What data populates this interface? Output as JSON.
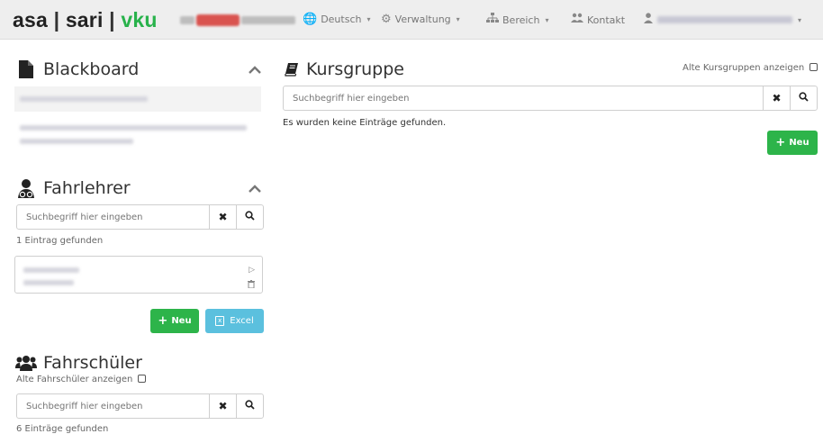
{
  "navbar": {
    "brand": {
      "part1": "asa",
      "part2": "sari",
      "part3": "vku",
      "separator": "|"
    },
    "language": {
      "label": "Deutsch",
      "icon": "globe-icon"
    },
    "admin": {
      "label": "Verwaltung",
      "icon": "cogs-icon"
    },
    "area": {
      "label": "Bereich",
      "icon": "sitemap-icon"
    },
    "contact": {
      "label": "Kontakt",
      "icon": "contacts-icon"
    },
    "user": {
      "icon": "user-icon"
    }
  },
  "blackboard": {
    "title": "Blackboard",
    "icon": "file-icon"
  },
  "fahrlehrer": {
    "title": "Fahrlehrer",
    "icon": "driving-instructor-icon",
    "search_placeholder": "Suchbegriff hier eingeben",
    "count_text": "1 Eintrag gefunden",
    "new_button": "Neu",
    "excel_button": "Excel"
  },
  "fahrschueler": {
    "title": "Fahrschüler",
    "icon": "users-icon",
    "show_old_label": "Alte Fahrschüler anzeigen",
    "search_placeholder": "Suchbegriff hier eingeben",
    "count_text": "6 Einträge gefunden"
  },
  "kursgruppe": {
    "title": "Kursgruppe",
    "icon": "book-icon",
    "show_old_label": "Alte Kursgruppen anzeigen",
    "search_placeholder": "Suchbegriff hier eingeben",
    "empty_text": "Es wurden keine Einträge gefunden.",
    "new_button": "Neu"
  },
  "colors": {
    "brand_green": "#28b24b",
    "button_green": "#2db44a",
    "button_blue": "#5bc0de",
    "badge_red": "#d9534f"
  }
}
